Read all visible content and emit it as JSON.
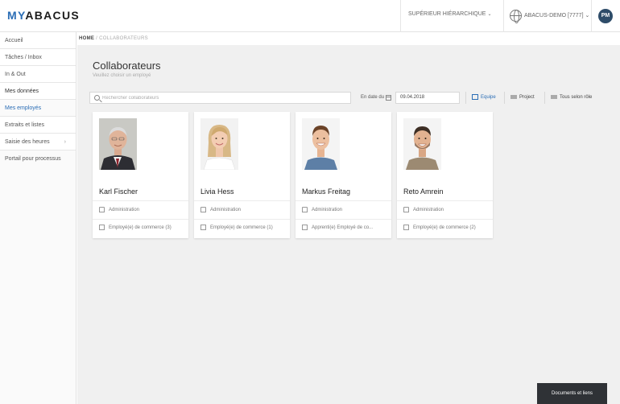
{
  "brand": {
    "prefix": "MY",
    "name": "ABACUS"
  },
  "header": {
    "role_label": "SUPÉRIEUR HIÉRARCHIQUE",
    "mandant_label": "ABACUS-DEMO [7777]",
    "user_initials": "PM"
  },
  "sidebar": {
    "items": [
      {
        "label": "Accueil"
      },
      {
        "label": "Tâches / Inbox"
      },
      {
        "label": "In & Out"
      },
      {
        "label": "Mes données"
      },
      {
        "label": "Mes employés"
      },
      {
        "label": "Extraits et listes"
      },
      {
        "label": "Saisie des heures"
      },
      {
        "label": "Portail pour processus"
      }
    ]
  },
  "breadcrumb": {
    "home": "HOME",
    "current": "COLLABORATEURS"
  },
  "page": {
    "title": "Collaborateurs",
    "subtitle": "Veuillez choisir un employé"
  },
  "toolbar": {
    "search_placeholder": "Rechercher collaborateurs",
    "date_label": "En date du",
    "date_value": "09.04.2018",
    "views": {
      "equipe": "Equipe",
      "project": "Project",
      "all_roles": "Tous selon rôle"
    }
  },
  "employees": [
    {
      "name": "Karl Fischer",
      "role": "Administration",
      "job": "Employé(e) de commerce (3)"
    },
    {
      "name": "Livia Hess",
      "role": "Administration",
      "job": "Employé(e) de commerce (1)"
    },
    {
      "name": "Markus Freitag",
      "role": "Administration",
      "job": "Apprenti(e) Employé de co..."
    },
    {
      "name": "Reto Amrein",
      "role": "Administration",
      "job": "Employé(e) de commerce (2)"
    }
  ],
  "footer": {
    "documents_button": "Documents et liens"
  },
  "colors": {
    "accent": "#2a6db5",
    "avatar": "#2e4c69",
    "button_dark": "#2f3236"
  }
}
